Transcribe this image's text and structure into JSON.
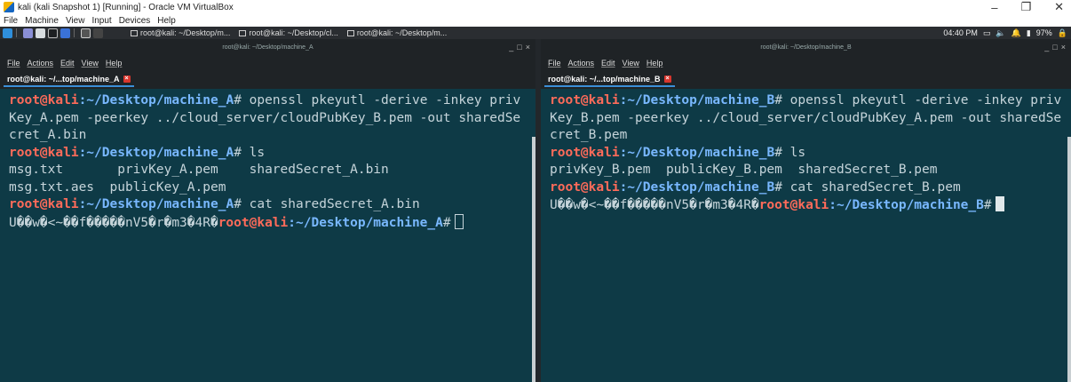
{
  "vbox": {
    "title": "kali (kali Snapshot 1) [Running] - Oracle VM VirtualBox",
    "menu": [
      "File",
      "Machine",
      "View",
      "Input",
      "Devices",
      "Help"
    ],
    "controls": [
      "–",
      "❐",
      "✕"
    ]
  },
  "panel": {
    "tasks": [
      "root@kali: ~/Desktop/m...",
      "root@kali: ~/Desktop/cl...",
      "root@kali: ~/Desktop/m..."
    ],
    "time": "04:40 PM",
    "battery": "97%"
  },
  "term_a": {
    "window_title": "root@kali: ~/Desktop/machine_A",
    "menu": [
      "File",
      "Actions",
      "Edit",
      "View",
      "Help"
    ],
    "tab_label": "root@kali: ~/...top/machine_A",
    "prompt_user": "root@kali",
    "prompt_path": ":~/Desktop/machine_A",
    "prompt_sym": "#",
    "cmd1": " openssl pkeyutl -derive -inkey privKey_A.pem -peerkey ../cloud_server/cloudPubKey_B.pem -out sharedSecret_A.bin",
    "cmd2": " ls",
    "ls_row1": "msg.txt       privKey_A.pem    sharedSecret_A.bin",
    "ls_row2": "msg.txt.aes  publicKey_A.pem",
    "cmd3": " cat sharedSecret_A.bin",
    "output": "U��w�<~��f�����nV5�r�m3�4R�"
  },
  "term_b": {
    "window_title": "root@kali: ~/Desktop/machine_B",
    "menu": [
      "File",
      "Actions",
      "Edit",
      "View",
      "Help"
    ],
    "tab_label": "root@kali: ~/...top/machine_B",
    "prompt_user": "root@kali",
    "prompt_path": ":~/Desktop/machine_B",
    "prompt_sym": "#",
    "cmd1": " openssl pkeyutl -derive -inkey privKey_B.pem -peerkey ../cloud_server/cloudPubKey_A.pem -out sharedSecret_B.pem",
    "cmd2": " ls",
    "ls_row1": "privKey_B.pem  publicKey_B.pem  sharedSecret_B.pem",
    "cmd3": " cat sharedSecret_B.pem",
    "output": "U��w�<~��f�����nV5�r�m3�4R�"
  }
}
